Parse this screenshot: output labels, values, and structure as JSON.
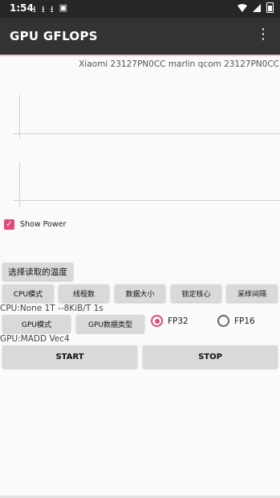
{
  "status_bar": {
    "time": "1:54",
    "notification_icons": [
      "download-icon",
      "download-icon",
      "download-icon",
      "a-icon"
    ],
    "system_icons": [
      "wifi-icon",
      "signal-icon",
      "battery-icon"
    ]
  },
  "app_bar": {
    "title": "GPU GFLOPS",
    "menu_icon": "more-vert-icon"
  },
  "device_info": "Xiaomi 23127PN0CC marlin qcom 23127PN0CC",
  "show_power": {
    "label": "Show Power",
    "checked": true
  },
  "temp_button": "选择读取的温度",
  "cpu_buttons": [
    "CPU模式",
    "线程数",
    "数据大小",
    "锁定核心",
    "采样间隔"
  ],
  "cpu_info": "CPU:None 1T --8KiB/T 1s",
  "gpu_buttons": [
    "GPU模式",
    "GPU数据类型"
  ],
  "precision": {
    "fp32": {
      "label": "FP32",
      "selected": true
    },
    "fp16": {
      "label": "FP16",
      "selected": false
    }
  },
  "gpu_info": "GPU:MADD Vec4",
  "start_label": "START",
  "stop_label": "STOP",
  "colors": {
    "accent": "#e24a7b",
    "appbar": "#333333",
    "statusbar": "#262626"
  }
}
